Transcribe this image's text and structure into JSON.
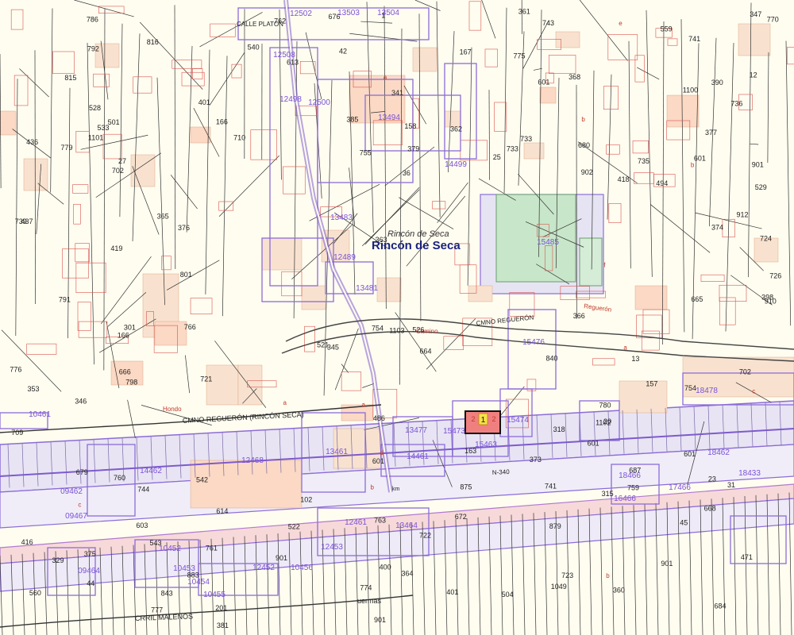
{
  "map": {
    "place_name": "Rincón de Seca",
    "place_name_italic": "Rincón de Seca",
    "selected_parcel": {
      "number": "1",
      "sub_a": "2",
      "sub_b": "2"
    },
    "roads": [
      {
        "id": "cmno-reguerón-rincón-seca",
        "label": "CMNO REGUERÓN (RINCÓN SECA)"
      },
      {
        "id": "cmno-reguerón-north",
        "label": "CMNO REGUERÓN"
      },
      {
        "id": "calle-platón",
        "label": "CALLE PLATON"
      },
      {
        "id": "n-340",
        "label": "N-340"
      },
      {
        "id": "crril-malenos",
        "label": "CRRIL MALENOS"
      },
      {
        "id": "camino",
        "label": "Camino"
      },
      {
        "id": "reguerón",
        "label": "Reguerón"
      },
      {
        "id": "hondo",
        "label": "Hondo"
      },
      {
        "id": "km",
        "label": "km"
      },
      {
        "id": "uermas",
        "label": "uermas"
      }
    ],
    "purple_parcel_labels": [
      "15485",
      "15476",
      "15463",
      "15474",
      "15473",
      "13477",
      "13461",
      "13464",
      "12468",
      "12489",
      "12498",
      "13494",
      "13483",
      "13481",
      "13503",
      "13504",
      "14461",
      "14462",
      "18478",
      "18462",
      "18433",
      "18466",
      "17466",
      "16466",
      "09462",
      "09467",
      "09464",
      "10452",
      "10453",
      "10454",
      "10455",
      "10456",
      "12452",
      "12453",
      "12461",
      "12502",
      "12508",
      "12500",
      "14499",
      "10461"
    ],
    "black_parcel_labels": [
      "436",
      "201",
      "385",
      "601",
      "381",
      "901",
      "390",
      "318",
      "329",
      "373",
      "374",
      "379",
      "375",
      "376",
      "365",
      "364",
      "347",
      "345",
      "401",
      "486",
      "158",
      "504",
      "346",
      "157",
      "353",
      "702",
      "601",
      "366",
      "471",
      "42",
      "44",
      "45",
      "102",
      "755",
      "801",
      "754",
      "760",
      "762",
      "761",
      "763",
      "401",
      "901",
      "759",
      "766",
      "770",
      "774",
      "775",
      "776",
      "780",
      "777",
      "883",
      "779",
      "301",
      "739",
      "743",
      "741",
      "733",
      "724",
      "723",
      "722",
      "721",
      "726",
      "702",
      "559",
      "560",
      "542",
      "786",
      "744",
      "601",
      "901",
      "902",
      "687",
      "684",
      "679",
      "680",
      "666",
      "664",
      "665",
      "613",
      "676",
      "672",
      "668",
      "791",
      "798",
      "792",
      "735",
      "736",
      "710",
      "709",
      "614",
      "13",
      "12",
      "400",
      "398",
      "416",
      "23",
      "27",
      "36",
      "601",
      "25",
      "20",
      "368",
      "315",
      "419",
      "418",
      "377",
      "31",
      "521",
      "522",
      "341",
      "601",
      "1",
      "603",
      "163",
      "167",
      "166",
      "494",
      "437",
      "166",
      "529",
      "528",
      "533",
      "540",
      "543",
      "526",
      "843",
      "875",
      "879",
      "901",
      "733",
      "910",
      "912",
      "840",
      "741",
      "754",
      "815",
      "816",
      "1100",
      "1101",
      "1102",
      "1103",
      "501",
      "360",
      "361",
      "363",
      "362",
      "1049"
    ],
    "small_red_labels": [
      "a",
      "b",
      "c",
      "d",
      "e",
      "f",
      "a",
      "b",
      "a",
      "b",
      "c",
      "a",
      "b"
    ]
  }
}
